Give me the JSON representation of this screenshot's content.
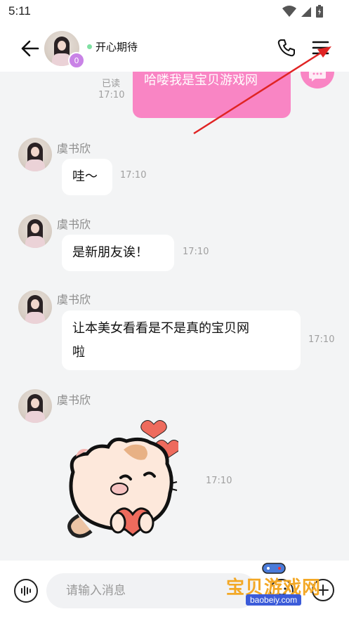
{
  "status_bar": {
    "time": "5:11"
  },
  "header": {
    "contact_name": "开心期待",
    "badge_text": "0"
  },
  "messages": {
    "own": {
      "text": "哈喽我是宝贝游戏网",
      "read_status": "已读",
      "time": "17:10"
    },
    "incoming": [
      {
        "sender": "虞书欣",
        "text": "哇～",
        "time": "17:10"
      },
      {
        "sender": "虞书欣",
        "text": "是新朋友诶！",
        "time": "17:10"
      },
      {
        "sender": "虞书欣",
        "line1": "让本美女看看是不是真的宝贝网",
        "line2": "啦",
        "time": "17:10"
      },
      {
        "sender": "虞书欣",
        "type": "sticker",
        "time": "17:10"
      }
    ]
  },
  "input": {
    "placeholder": "请输入消息"
  },
  "watermark": {
    "title": "宝贝游戏网",
    "url": "baobeiy.com"
  },
  "colors": {
    "accent_pink": "#f985c4",
    "online_green": "#7fe0a2",
    "annotation_red": "#e02424"
  },
  "icons": [
    "back-arrow-icon",
    "phone-icon",
    "menu-icon",
    "voice-icon",
    "emoji-icon",
    "plus-icon",
    "chat-bubble-icon"
  ]
}
